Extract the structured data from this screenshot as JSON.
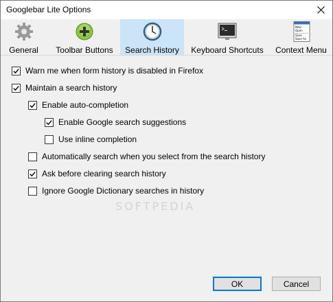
{
  "window": {
    "title": "Googlebar Lite Options"
  },
  "tabs": [
    {
      "label": "General",
      "icon": "gear-icon"
    },
    {
      "label": "Toolbar Buttons",
      "icon": "plus-icon"
    },
    {
      "label": "Search History",
      "icon": "clock-icon",
      "selected": true
    },
    {
      "label": "Keyboard Shortcuts",
      "icon": "terminal-icon"
    },
    {
      "label": "Context Menu",
      "icon": "context-menu-icon"
    }
  ],
  "options": [
    {
      "label": "Warn me when form history is disabled in Firefox",
      "checked": true
    },
    {
      "label": "Maintain a search history",
      "checked": true
    },
    {
      "label": "Enable auto-completion",
      "checked": true
    },
    {
      "label": "Enable Google search suggestions",
      "checked": true
    },
    {
      "label": "Use inline completion",
      "checked": false
    },
    {
      "label": "Automatically search when you select from the search history",
      "checked": false
    },
    {
      "label": "Ask before clearing search history",
      "checked": true
    },
    {
      "label": "Ignore Google Dictionary searches in history",
      "checked": false
    }
  ],
  "buttons": {
    "ok": "OK",
    "cancel": "Cancel"
  },
  "watermark": "SOFTPEDIA",
  "context_menu_icon_text": [
    "New",
    "Open",
    "Save",
    "Save As"
  ],
  "colors": {
    "selected_tab": "#cce4f7",
    "default_button_border": "#0078d7"
  }
}
